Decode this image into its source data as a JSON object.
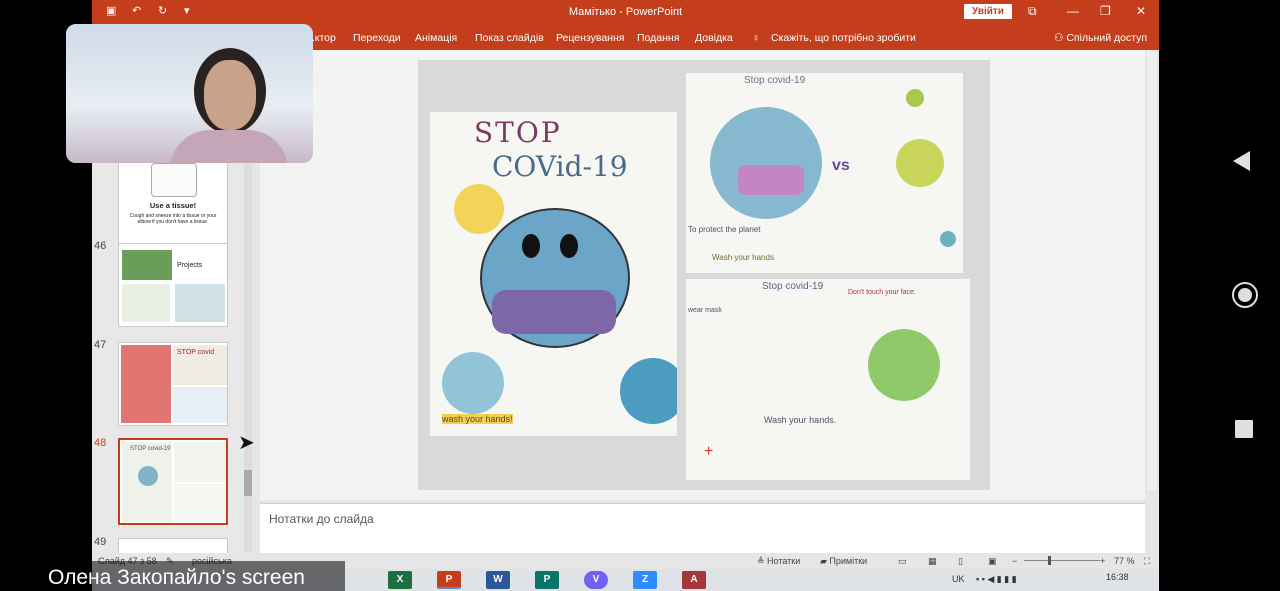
{
  "window": {
    "title": "Мамітько - PowerPoint",
    "signin_label": "Увійти",
    "quick_access": [
      "save",
      "undo",
      "redo",
      "customize"
    ]
  },
  "ribbon": {
    "tabs": [
      "...ктор",
      "Переходи",
      "Анімація",
      "Показ слайдів",
      "Рецензування",
      "Подання",
      "Довідка"
    ],
    "tell_me": "Скажіть, що потрібно зробити",
    "share": "Спільний доступ"
  },
  "thumbnails": [
    {
      "number": "",
      "title": "Use a tissue!",
      "text": "Cough and sneeze into a tissue or your elbow if you don't have a tissue."
    },
    {
      "number": "46",
      "title": "Projects"
    },
    {
      "number": "47",
      "title": "STOP covid"
    },
    {
      "number": "48",
      "title": "STOP covid-19",
      "active": true
    },
    {
      "number": "49",
      "title": ""
    }
  ],
  "slide": {
    "left_drawing": {
      "title_line1": "STOP",
      "title_line2": "COVid-19",
      "caption": "wash your hands!"
    },
    "top_right_drawing": {
      "title": "Stop covid-19",
      "vs": "vs",
      "caption1": "To protect the planet",
      "caption2": "Wash your hands"
    },
    "bottom_right_drawing": {
      "title": "Stop covid-19",
      "caption_top": "Don't touch your face.",
      "caption_left": "wear mask",
      "caption_center": "Wash your hands."
    }
  },
  "notes": {
    "placeholder": "Нотатки до слайда"
  },
  "status": {
    "slide_info": "Слайд 47 з 58",
    "language": "російська",
    "notes_label": "Нотатки",
    "comments_label": "Примітки",
    "zoom": "77 %"
  },
  "taskbar": {
    "apps": [
      "X",
      "P",
      "W",
      "P",
      "V",
      "Z",
      "A"
    ],
    "lang": "UK",
    "time": "16:38"
  },
  "webcam": {
    "participant": "Олена Закопайло"
  },
  "screen_label": "Олена Закопайло's screen",
  "colors": {
    "accent": "#c43e1c"
  }
}
